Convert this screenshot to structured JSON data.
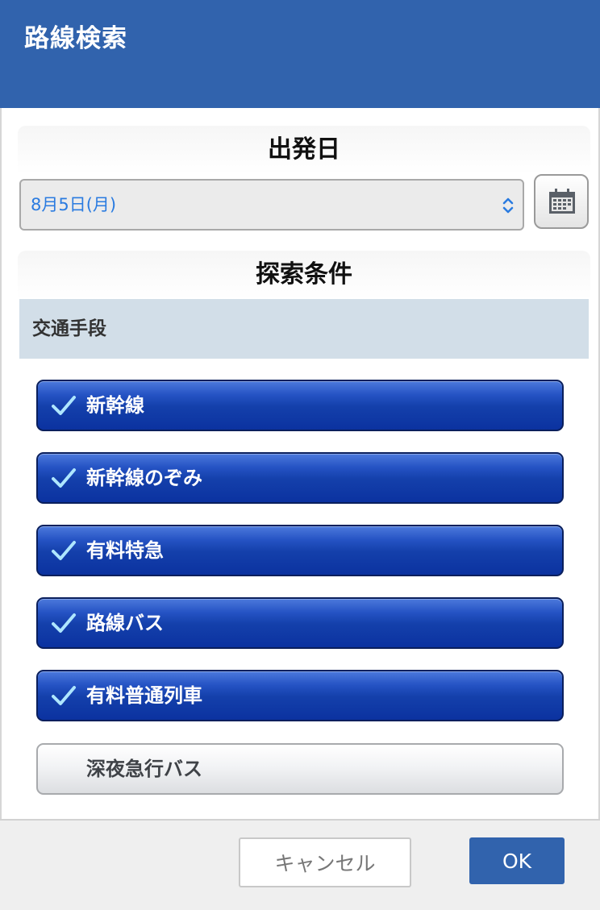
{
  "header": {
    "title": "路線検索"
  },
  "date_section": {
    "heading": "出発日",
    "selected_date": "8月5日(月)",
    "calendar_icon": "calendar-icon"
  },
  "conditions_section": {
    "heading": "探索条件",
    "subheading": "交通手段",
    "options": [
      {
        "label": "新幹線",
        "checked": true
      },
      {
        "label": "新幹線のぞみ",
        "checked": true
      },
      {
        "label": "有料特急",
        "checked": true
      },
      {
        "label": "路線バス",
        "checked": true
      },
      {
        "label": "有料普通列車",
        "checked": true
      },
      {
        "label": "深夜急行バス",
        "checked": false
      }
    ]
  },
  "footer": {
    "cancel_label": "キャンセル",
    "ok_label": "OK"
  },
  "colors": {
    "header_bg": "#3163ad",
    "accent_text": "#2a7be0",
    "checked_button": "#1440ab",
    "subheading_bg": "#d2dee8"
  }
}
